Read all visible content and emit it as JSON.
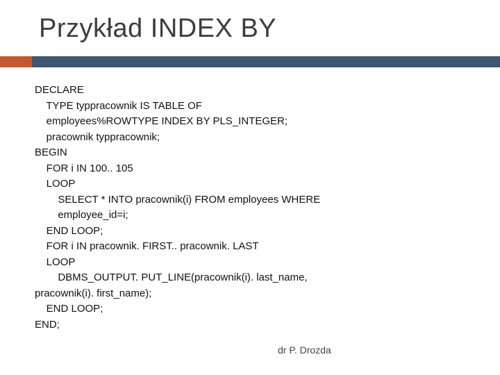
{
  "title": "Przykład INDEX BY",
  "code": "DECLARE\n    TYPE typpracownik IS TABLE OF\n    employees%ROWTYPE INDEX BY PLS_INTEGER;\n    pracownik typpracownik;\nBEGIN\n    FOR i IN 100.. 105\n    LOOP\n        SELECT * INTO pracownik(i) FROM employees WHERE\n        employee_id=i;\n    END LOOP;\n    FOR i IN pracownik. FIRST.. pracownik. LAST\n    LOOP\n        DBMS_OUTPUT. PUT_LINE(pracownik(i). last_name,\npracownik(i). first_name);\n    END LOOP;\nEND;",
  "author": "dr P. Drozda"
}
